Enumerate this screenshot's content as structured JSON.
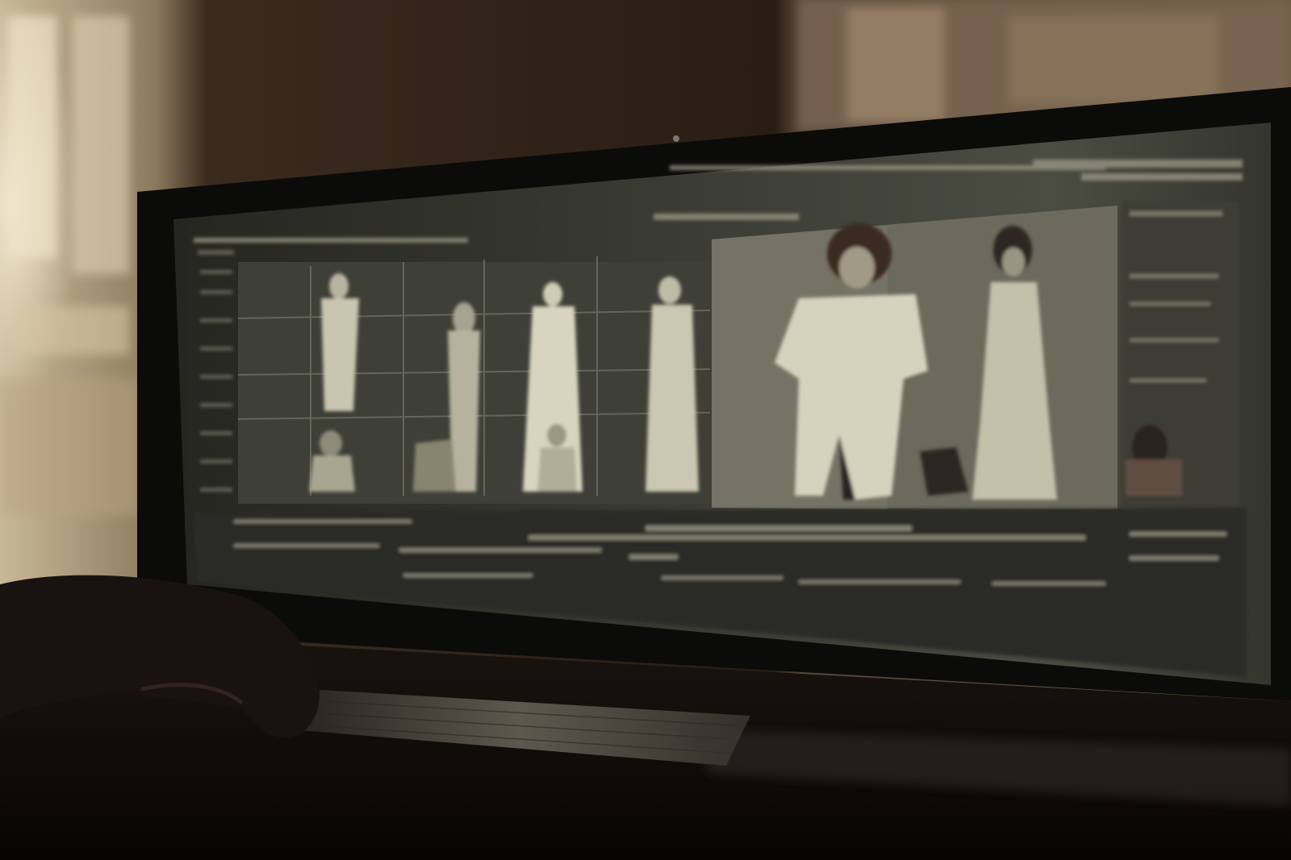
{
  "scene": {
    "description_tokens": [],
    "palette": {
      "room_dark": "#1a120c",
      "wall_brown": "#3a2a1e",
      "window_light": "#e8dcc2",
      "monitor_bezel": "#0c0c0c",
      "screen_bg": "#2b2c27",
      "screen_panel": "#5a5b50",
      "screen_highlight": "#d9d6c4",
      "figure_light": "#c9c6b2",
      "figure_mid": "#8e8b78",
      "desk_dark": "#0a0806",
      "keyboard": "#4a4640",
      "hand": "#1c1512"
    },
    "icons": [
      "window-light",
      "ornate-frame",
      "monitor",
      "keyboard",
      "hand"
    ]
  }
}
